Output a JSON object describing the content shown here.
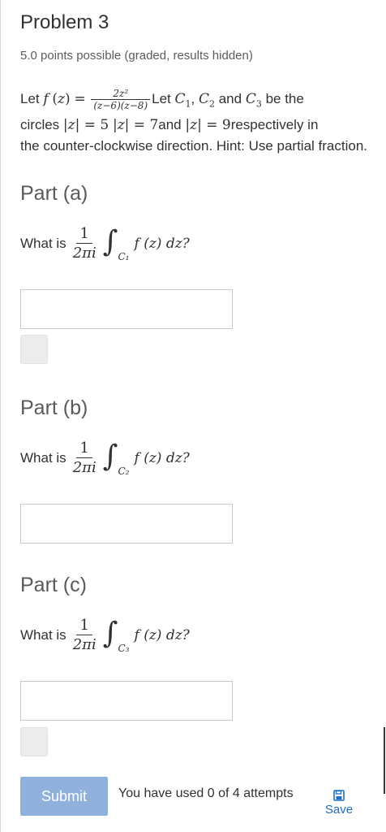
{
  "problem": {
    "title": "Problem 3",
    "points": "5.0 points possible (graded, results hidden)",
    "text_let": "Let",
    "text_mid": "Let",
    "text_and": "and",
    "text_be_the": "be the",
    "text_circles": "circles",
    "text_and2": "and",
    "text_respectively": "respectively in",
    "text_tail": "the counter-clockwise direction. Hint: Use partial fraction.",
    "fraction_num": "2z²",
    "fraction_den": "(z−6)(z−8)",
    "r1": "5",
    "r2": "7",
    "r3": "9"
  },
  "parts": [
    {
      "title": "Part (a)",
      "question_prefix": "What is",
      "contour": "C₁",
      "answer_value": ""
    },
    {
      "title": "Part (b)",
      "question_prefix": "What is",
      "contour": "C₂",
      "answer_value": ""
    },
    {
      "title": "Part (c)",
      "question_prefix": "What is",
      "contour": "C₃",
      "answer_value": ""
    }
  ],
  "math": {
    "one": "1",
    "two_pi_i": "2πi",
    "integral": "∫",
    "integrand": "f (z) dz?"
  },
  "footer": {
    "submit_label": "Submit",
    "attempts_text": "You have used 0 of 4 attempts",
    "save_label": "Save",
    "save_icon": "floppy-disk-icon"
  },
  "colors": {
    "submit_bg": "#8fb1db",
    "link": "#1f6dc4"
  }
}
